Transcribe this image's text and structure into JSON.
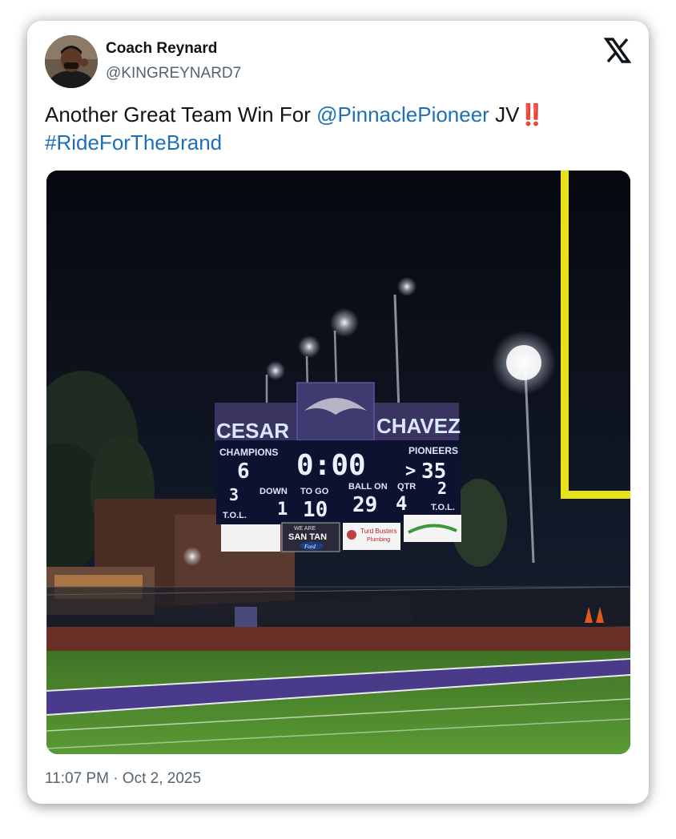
{
  "tweet": {
    "author_name": "Coach Reynard",
    "author_handle": "@KINGREYNARD7",
    "text_before": "Another Great Team Win For ",
    "mention": "@PinnaclePioneer",
    "text_after": " JV",
    "emoji": "‼️",
    "hashtag": "#RideForTheBrand",
    "timestamp": "11:07 PM · Oct 2, 2025",
    "logo_icon": "x-logo-icon"
  },
  "scoreboard": {
    "stadium_left": "CESAR",
    "stadium_right": "CHAVEZ",
    "home_label": "CHAMPIONS",
    "home_score": "6",
    "clock": "0:00",
    "guest_label": "PIONEERS",
    "guest_score": "35",
    "possession_marker": ">",
    "home_timeouts": "3",
    "guest_timeouts": "2",
    "tol_label": "T.O.L.",
    "down_label": "DOWN",
    "down": "1",
    "togo_label": "TO GO",
    "togo": "10",
    "ballon_label": "BALL ON",
    "ballon": "29",
    "qtr_label": "QTR",
    "qtr": "4",
    "sponsor_1_line1": "WE ARE",
    "sponsor_1_line2": "SAN TAN",
    "sponsor_1_line3": "Ford",
    "sponsor_2": "Turd Busters",
    "sponsor_2_sub": "Plumbing"
  },
  "colors": {
    "link": "#1d6fb8",
    "field_green": "#4f8a2e",
    "endzone_purple": "#4a3a8a",
    "goalpost_yellow": "#e8e01a"
  }
}
